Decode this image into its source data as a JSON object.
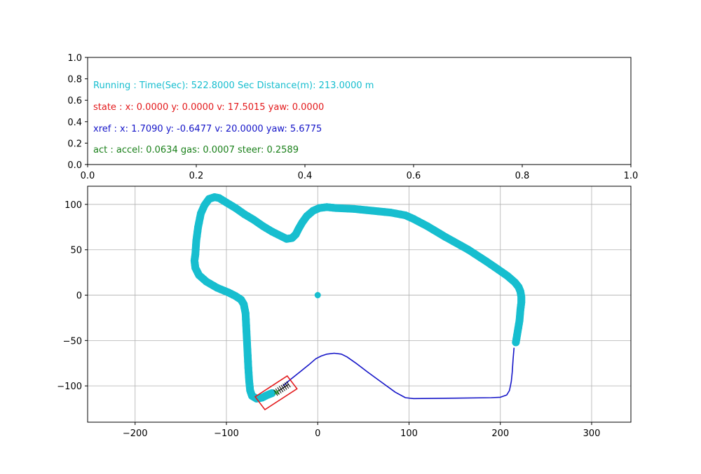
{
  "chart_data": [
    {
      "type": "text-panel",
      "xlim": [
        0.0,
        1.0
      ],
      "ylim": [
        0.0,
        1.0
      ],
      "x_ticks": [
        "0.0",
        "0.2",
        "0.4",
        "0.6",
        "0.8",
        "1.0"
      ],
      "y_ticks": [
        "0.0",
        "0.2",
        "0.4",
        "0.6",
        "0.8",
        "1.0"
      ],
      "lines": [
        {
          "text": "Running : Time(Sec): 522.8000 Sec Distance(m): 213.0000 m",
          "color": "#17becf"
        },
        {
          "text": "state :  x: 0.0000 y: 0.0000 v: 17.5015 yaw: 0.0000",
          "color": "#e31a1c"
        },
        {
          "text": "xref :  x: 1.7090 y: -0.6477 v: 20.0000 yaw: 5.6775",
          "color": "#1515c8"
        },
        {
          "text": "act :  accel: 0.0634 gas: 0.0007 steer: 0.2589",
          "color": "#1a801a"
        }
      ]
    },
    {
      "type": "line",
      "xlim": [
        -252,
        343
      ],
      "ylim": [
        -140,
        120
      ],
      "grid": true,
      "x_ticks": [
        -200,
        -100,
        0,
        100,
        200,
        300
      ],
      "y_ticks": [
        -100,
        -50,
        0,
        50,
        100
      ],
      "x_tick_labels": [
        "−200",
        "−100",
        "0",
        "100",
        "200",
        "300"
      ],
      "y_tick_labels": [
        "−100",
        "−50",
        "0",
        "50",
        "100"
      ],
      "series": [
        {
          "style": "trajectory-dots",
          "color": "#17becf",
          "points": [
            [
              217,
              -52
            ],
            [
              219,
              -40
            ],
            [
              221,
              -28
            ],
            [
              222,
              -16
            ],
            [
              223,
              -8
            ],
            [
              223,
              -2
            ],
            [
              222,
              4
            ],
            [
              220,
              9
            ],
            [
              216,
              14
            ],
            [
              208,
              21
            ],
            [
              198,
              28
            ],
            [
              185,
              37
            ],
            [
              165,
              50
            ],
            [
              140,
              64
            ],
            [
              120,
              76
            ],
            [
              105,
              84
            ],
            [
              96,
              88
            ],
            [
              80,
              91
            ],
            [
              60,
              93
            ],
            [
              40,
              95
            ],
            [
              20,
              96
            ],
            [
              10,
              97
            ],
            [
              2,
              96
            ],
            [
              -5,
              93
            ],
            [
              -12,
              87
            ],
            [
              -17,
              80
            ],
            [
              -21,
              73
            ],
            [
              -24,
              67
            ],
            [
              -28,
              63
            ],
            [
              -34,
              62
            ],
            [
              -40,
              65
            ],
            [
              -50,
              70
            ],
            [
              -60,
              76
            ],
            [
              -70,
              83
            ],
            [
              -80,
              89
            ],
            [
              -90,
              96
            ],
            [
              -100,
              102
            ],
            [
              -108,
              107
            ],
            [
              -113,
              108
            ],
            [
              -119,
              106
            ],
            [
              -124,
              99
            ],
            [
              -128,
              90
            ],
            [
              -131,
              75
            ],
            [
              -133,
              60
            ],
            [
              -134,
              45
            ],
            [
              -135,
              38
            ],
            [
              -134,
              30
            ],
            [
              -130,
              22
            ],
            [
              -122,
              15
            ],
            [
              -110,
              8
            ],
            [
              -98,
              3
            ],
            [
              -90,
              -1
            ],
            [
              -84,
              -5
            ],
            [
              -81,
              -10
            ],
            [
              -79,
              -20
            ],
            [
              -78,
              -40
            ],
            [
              -77,
              -60
            ],
            [
              -76,
              -80
            ],
            [
              -75,
              -95
            ],
            [
              -74,
              -105
            ],
            [
              -72,
              -111
            ],
            [
              -67,
              -114
            ],
            [
              -61,
              -113
            ],
            [
              -55,
              -110
            ],
            [
              -50,
              -108
            ]
          ]
        },
        {
          "style": "single-dot",
          "color": "#17becf",
          "points": [
            [
              0,
              0
            ]
          ]
        },
        {
          "style": "reference-line",
          "color": "#1515c8",
          "points": [
            [
              -38,
              -100
            ],
            [
              -30,
              -93
            ],
            [
              -20,
              -85
            ],
            [
              -10,
              -77
            ],
            [
              -2,
              -70
            ],
            [
              4,
              -67
            ],
            [
              10,
              -65
            ],
            [
              18,
              -64
            ],
            [
              26,
              -65
            ],
            [
              32,
              -68
            ],
            [
              42,
              -75
            ],
            [
              55,
              -85
            ],
            [
              70,
              -96
            ],
            [
              85,
              -107
            ],
            [
              96,
              -113
            ],
            [
              105,
              -114
            ],
            [
              150,
              -113.5
            ],
            [
              190,
              -113
            ],
            [
              200,
              -112.5
            ],
            [
              207,
              -110
            ],
            [
              210,
              -105
            ],
            [
              212,
              -95
            ],
            [
              213,
              -85
            ],
            [
              214,
              -70
            ],
            [
              215,
              -58
            ]
          ]
        },
        {
          "style": "vehicle-box",
          "color": "#e31a1c",
          "points": [
            [
              -68.5,
              -112
            ],
            [
              -57.8,
              -126.2
            ],
            [
              -22.7,
              -103.2
            ],
            [
              -33.4,
              -89
            ]
          ]
        },
        {
          "style": "vehicle-axle",
          "color": "#000000",
          "points": [
            [
              -46,
              -107.5
            ],
            [
              -32,
              -98.3
            ]
          ]
        },
        {
          "style": "vehicle-marker",
          "color": "#2ca02c",
          "points": [
            [
              -45,
              -107
            ]
          ]
        }
      ]
    }
  ]
}
